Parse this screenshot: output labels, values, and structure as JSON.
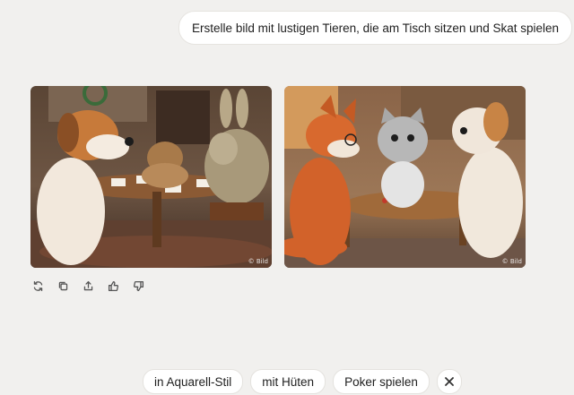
{
  "conversation": {
    "user_message": "Erstelle bild mit lustigen Tieren, die am Tisch sitzen und Skat spielen"
  },
  "images": [
    {
      "badge": "© Bild",
      "icon": "generated-image"
    },
    {
      "badge": "© Bild",
      "icon": "generated-image"
    }
  ],
  "actions": [
    {
      "icon": "regenerate-icon"
    },
    {
      "icon": "copy-icon"
    },
    {
      "icon": "share-icon"
    },
    {
      "icon": "thumbs-up-icon"
    },
    {
      "icon": "thumbs-down-icon"
    }
  ],
  "suggestions": {
    "chips": [
      "in Aquarell-Stil",
      "mit Hüten",
      "Poker spielen"
    ],
    "close_icon": "close-icon"
  }
}
